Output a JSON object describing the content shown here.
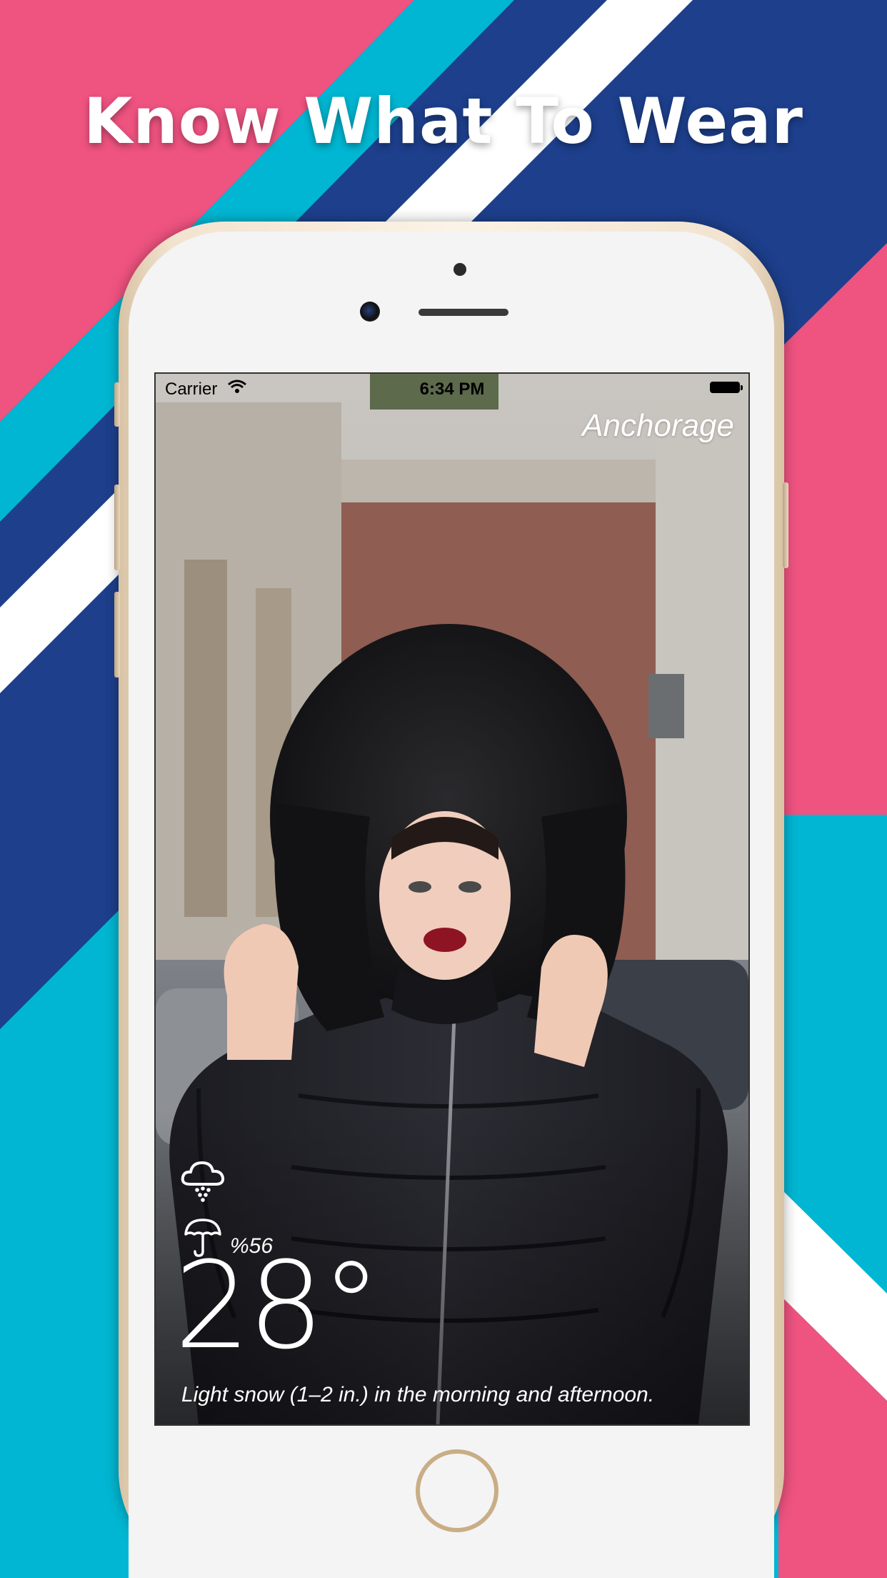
{
  "headline": "Know What To Wear",
  "status_bar": {
    "carrier": "Carrier",
    "time": "6:34 PM"
  },
  "weather": {
    "city": "Anchorage",
    "condition_icon": "snow-cloud-icon",
    "precip_icon": "umbrella-icon",
    "precip_probability": "%56",
    "temperature": "28°",
    "summary": "Light snow (1–2 in.) in the morning and afternoon."
  },
  "colors": {
    "pink": "#ef5380",
    "cyan": "#00b6d2",
    "navy": "#1d3f8c",
    "white": "#ffffff",
    "phone_gold": "#ead8bf"
  }
}
